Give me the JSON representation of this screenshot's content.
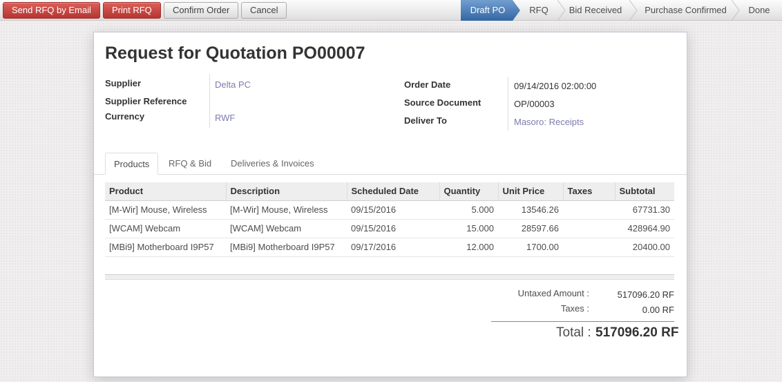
{
  "toolbar": {
    "send_rfq": "Send RFQ by Email",
    "print_rfq": "Print RFQ",
    "confirm_order": "Confirm Order",
    "cancel": "Cancel"
  },
  "statusbar": {
    "steps": [
      "Draft PO",
      "RFQ",
      "Bid Received",
      "Purchase Confirmed",
      "Done"
    ],
    "active": "Draft PO"
  },
  "form": {
    "title_prefix": "Request for Quotation",
    "title_number": "PO00007",
    "supplier_label": "Supplier",
    "supplier_value": "Delta PC",
    "supplier_ref_label": "Supplier Reference",
    "supplier_ref_value": "",
    "currency_label": "Currency",
    "currency_value": "RWF",
    "order_date_label": "Order Date",
    "order_date_value": "09/14/2016 02:00:00",
    "source_doc_label": "Source Document",
    "source_doc_value": "OP/00003",
    "deliver_to_label": "Deliver To",
    "deliver_to_value": "Masoro: Receipts"
  },
  "tabs": [
    "Products",
    "RFQ & Bid",
    "Deliveries & Invoices"
  ],
  "table": {
    "headers": [
      "Product",
      "Description",
      "Scheduled Date",
      "Quantity",
      "Unit Price",
      "Taxes",
      "Subtotal"
    ],
    "rows": [
      [
        "[M-Wir] Mouse, Wireless",
        "[M-Wir] Mouse, Wireless",
        "09/15/2016",
        "5.000",
        "13546.26",
        "",
        "67731.30"
      ],
      [
        "[WCAM] Webcam",
        "[WCAM] Webcam",
        "09/15/2016",
        "15.000",
        "28597.66",
        "",
        "428964.90"
      ],
      [
        "[MBi9] Motherboard I9P57",
        "[MBi9] Motherboard I9P57",
        "09/17/2016",
        "12.000",
        "1700.00",
        "",
        "20400.00"
      ]
    ]
  },
  "totals": {
    "untaxed_label": "Untaxed Amount :",
    "untaxed_value": "517096.20 RF",
    "taxes_label": "Taxes :",
    "taxes_value": "0.00 RF",
    "total_label": "Total :",
    "total_value": "517096.20 RF"
  },
  "colors": {
    "primary_button": "#c9302c",
    "active_step": "#4a7bbf",
    "link": "#7c7bad"
  }
}
